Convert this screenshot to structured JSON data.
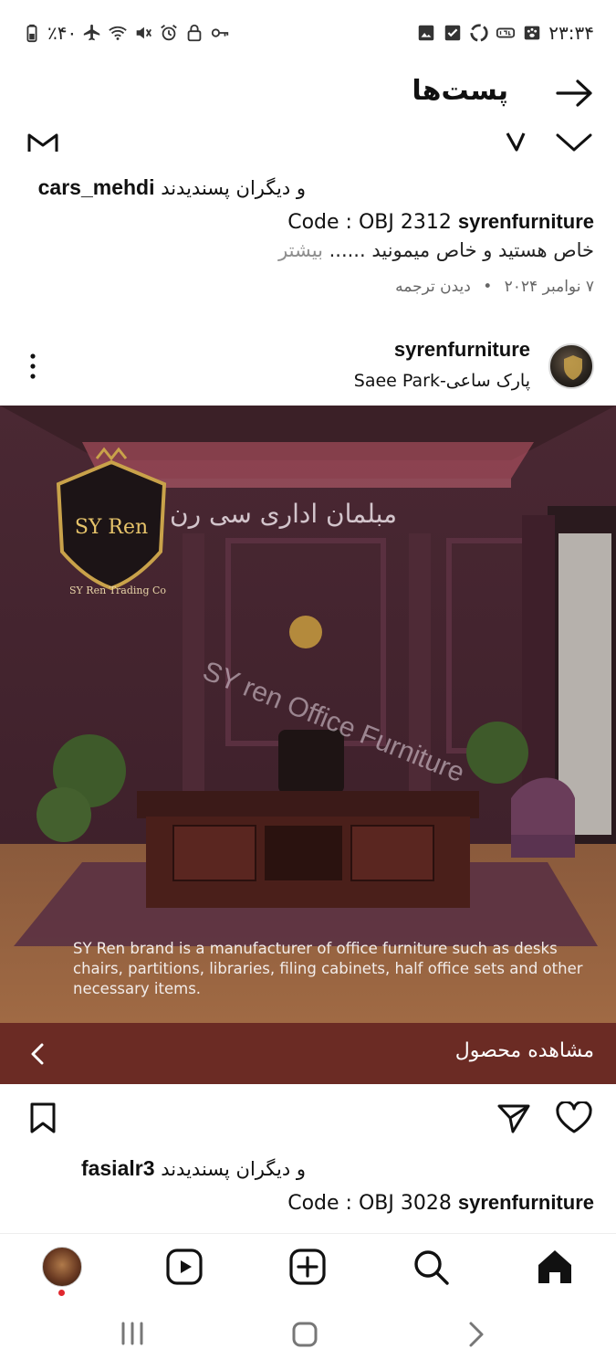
{
  "status_bar": {
    "time": "۲۳:۳۴",
    "battery": "٪۴۰",
    "left_icons": [
      "battery-icon",
      "airplane-icon",
      "wifi-icon",
      "mute-icon",
      "alarm-icon",
      "lock-icon",
      "key-icon"
    ],
    "right_icons": [
      "gallery-icon",
      "check-icon",
      "recycle-icon",
      "vpn-icon",
      "paw-icon"
    ]
  },
  "header": {
    "title": "پست‌ها",
    "back_icon": "arrow-right-icon"
  },
  "post_top": {
    "likes_user": "cars_mehdi",
    "likes_suffix": "و دیگران پسندیدند",
    "caption_user": "syrenfurniture",
    "caption_code": "Code : OBJ 2312",
    "caption_line2": "خاص هستید و خاص میمونید ......",
    "more_label": "بیشتر",
    "date": "۷ نوامبر ۲۰۲۴",
    "separator": "•",
    "translate_label": "دیدن ترجمه"
  },
  "post": {
    "author": "syrenfurniture",
    "location": "پارک ساعی-Saee Park",
    "menu_icon": "kebab-menu-icon",
    "image": {
      "logo_text": "SY Ren",
      "logo_subtitle": "SY Ren Trading Co",
      "headline": "مبلمان اداری سی رن",
      "watermark": "SY ren Office Furniture",
      "description": "SY Ren brand is a manufacturer of office furniture such as desks chairs, partitions, libraries, filing cabinets, half office sets and other necessary items."
    },
    "cta_label": "مشاهده محصول",
    "likes_user": "fasialr3",
    "likes_suffix": "و دیگران پسندیدند",
    "caption_user": "syrenfurniture",
    "caption_code": "Code : OBJ 3028"
  },
  "bottom_nav": {
    "items": [
      "profile-avatar",
      "reels-icon",
      "create-icon",
      "search-icon",
      "home-icon"
    ]
  },
  "system_nav": {
    "items": [
      "recents-icon",
      "home-button-icon",
      "back-icon"
    ]
  },
  "colors": {
    "cta_bg": "#6b2b24",
    "text_primary": "#111111",
    "text_muted": "#8e8e8e",
    "notification_dot": "#e0282e"
  }
}
